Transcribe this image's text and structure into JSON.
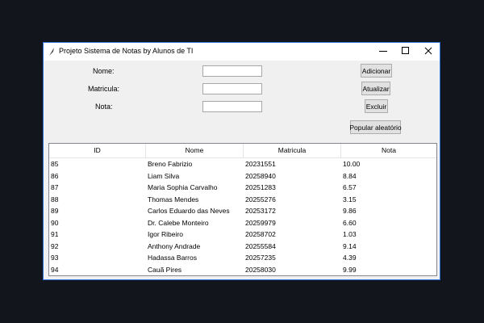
{
  "window": {
    "title": "Projeto Sistema de Notas  by Alunos de TI",
    "controls": {
      "minimize_icon": "minimize-icon",
      "maximize_icon": "maximize-icon",
      "close_icon": "close-icon"
    }
  },
  "form": {
    "nome_label": "Nome:",
    "matricula_label": "Matricula:",
    "nota_label": "Nota:",
    "nome_value": "",
    "matricula_value": "",
    "nota_value": ""
  },
  "buttons": {
    "adicionar": "Adicionar",
    "atualizar": "Atualizar",
    "excluir": "Excluir",
    "popular": "Popular aleatório"
  },
  "table": {
    "columns": [
      "ID",
      "Nome",
      "Matricula",
      "Nota"
    ],
    "rows": [
      [
        "85",
        "Breno Fabrizio",
        "20231551",
        "10.00"
      ],
      [
        "86",
        "Liam Silva",
        "20258940",
        "8.84"
      ],
      [
        "87",
        "Maria Sophia Carvalho",
        "20251283",
        "6.57"
      ],
      [
        "88",
        "Thomas Mendes",
        "20255276",
        "3.15"
      ],
      [
        "89",
        "Carlos Eduardo das Neves",
        "20253172",
        "9.86"
      ],
      [
        "90",
        "Dr. Calebe Monteiro",
        "20259979",
        "6.60"
      ],
      [
        "91",
        "Igor Ribeiro",
        "20258702",
        "1.03"
      ],
      [
        "92",
        "Anthony Andrade",
        "20255584",
        "9.14"
      ],
      [
        "93",
        "Hadassa Barros",
        "20257235",
        "4.39"
      ],
      [
        "94",
        "Cauã Pires",
        "20258030",
        "9.99"
      ]
    ]
  },
  "colors": {
    "background": "#13151d",
    "window_border": "#2a6fd6",
    "window_bg": "#f0f0f0"
  }
}
